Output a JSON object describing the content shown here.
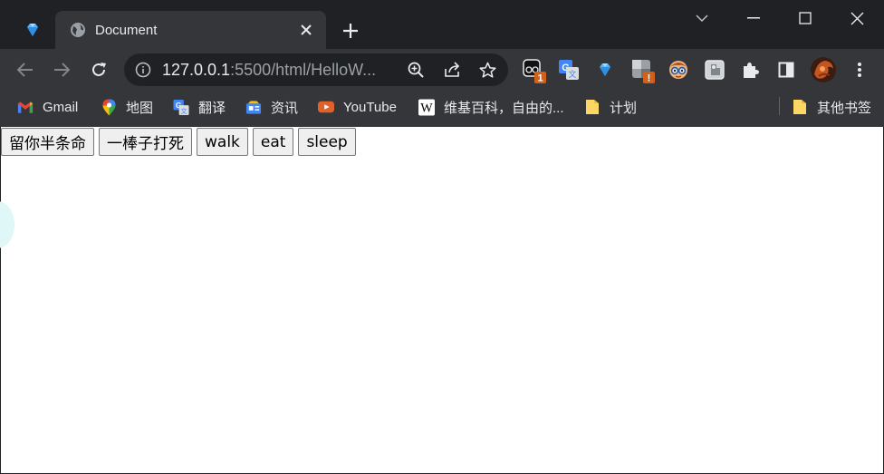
{
  "browser": {
    "pinned_tab": {
      "icon": "gem-icon"
    },
    "active_tab": {
      "title": "Document",
      "favicon": "globe-icon"
    },
    "window_controls": [
      "tab-search",
      "minimize",
      "maximize",
      "close"
    ],
    "address_bar": {
      "host": "127.0.0.1",
      "rest": ":5500/html/HelloW..."
    },
    "extensions": [
      {
        "name": "ext-stopwatch-icon",
        "badge": "1",
        "badge_color": "#d0601a"
      },
      {
        "name": "ext-translate-icon"
      },
      {
        "name": "ext-gem-icon"
      },
      {
        "name": "ext-alert-icon",
        "badge": "!",
        "badge_color": "#d0601a"
      },
      {
        "name": "ext-nerd-face-icon"
      },
      {
        "name": "ext-puzzle-box-icon"
      }
    ],
    "bookmarks": [
      {
        "label": "Gmail",
        "icon": "gmail-icon"
      },
      {
        "label": "地图",
        "icon": "maps-icon"
      },
      {
        "label": "翻译",
        "icon": "translate-icon"
      },
      {
        "label": "资讯",
        "icon": "news-icon"
      },
      {
        "label": "YouTube",
        "icon": "youtube-icon"
      },
      {
        "label": "维基百科，自由的...",
        "icon": "wikipedia-icon"
      },
      {
        "label": "计划",
        "icon": "folder-icon"
      }
    ],
    "other_bookmarks": {
      "label": "其他书签",
      "icon": "folder-icon"
    },
    "colors": {
      "tabstrip": "#202124",
      "toolbar": "#35363a",
      "text": "#e8eaed"
    }
  },
  "page": {
    "buttons": [
      {
        "label": "留你半条命"
      },
      {
        "label": "一棒子打死"
      },
      {
        "label": "walk"
      },
      {
        "label": "eat"
      },
      {
        "label": "sleep"
      }
    ]
  }
}
